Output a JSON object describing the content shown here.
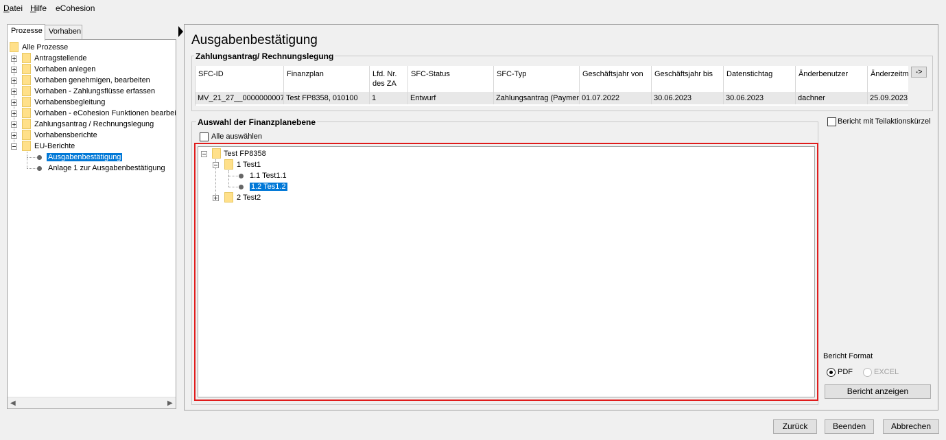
{
  "menu": {
    "items": [
      {
        "first": "D",
        "rest": "atei"
      },
      {
        "first": "H",
        "rest": "ilfe"
      },
      {
        "first": "",
        "rest": "eCohesion"
      }
    ]
  },
  "left": {
    "tabs": [
      "Prozesse",
      "Vorhaben"
    ],
    "tree": {
      "root": "Alle Prozesse",
      "items": [
        "Antragstellende",
        "Vorhaben anlegen",
        "Vorhaben genehmigen, bearbeiten",
        "Vorhaben - Zahlungsflüsse erfassen",
        "Vorhabensbegleitung",
        "Vorhaben - eCohesion Funktionen bearbeiten",
        "Zahlungsantrag / Rechnungslegung",
        "Vorhabensberichte",
        "EU-Berichte"
      ],
      "eu_children": [
        "Ausgabenbestätigung",
        "Anlage 1 zur Ausgabenbestätigung"
      ]
    }
  },
  "main": {
    "title": "Ausgabenbestätigung",
    "payment_group": {
      "legend": "Zahlungsantrag/ Rechnungslegung",
      "headers": [
        "SFC-ID",
        "Finanzplan",
        "Lfd. Nr. des ZA",
        "SFC-Status",
        "SFC-Typ",
        "Geschäftsjahr von",
        "Geschäftsjahr bis",
        "Datenstichtag",
        "Änderbenutzer",
        "Änderzeitm"
      ],
      "row": [
        "MV_21_27__0000000007",
        "Test FP8358, 010100",
        "1",
        "Entwurf",
        "Zahlungsantrag (Payment",
        "01.07.2022",
        "30.06.2023",
        "30.06.2023",
        "dachner",
        "25.09.2023"
      ],
      "next_button": "->"
    },
    "fp_group": {
      "legend": "Auswahl der Finanzplanebene",
      "select_all": "Alle auswählen",
      "tree": {
        "root": "Test FP8358",
        "node1": "1 Test1",
        "node1_children": [
          "1.1 Test1.1",
          "1.2 Tes1.2"
        ],
        "node2": "2 Test2"
      }
    },
    "teilaktion_checkbox": "Bericht mit Teilaktionskürzel",
    "format": {
      "label": "Bericht Format",
      "options": [
        "PDF",
        "EXCEL"
      ],
      "selected": "PDF"
    },
    "show_report_button": "Bericht anzeigen"
  },
  "footer": {
    "back": "Zurück",
    "finish": "Beenden",
    "cancel": "Abbrechen"
  }
}
